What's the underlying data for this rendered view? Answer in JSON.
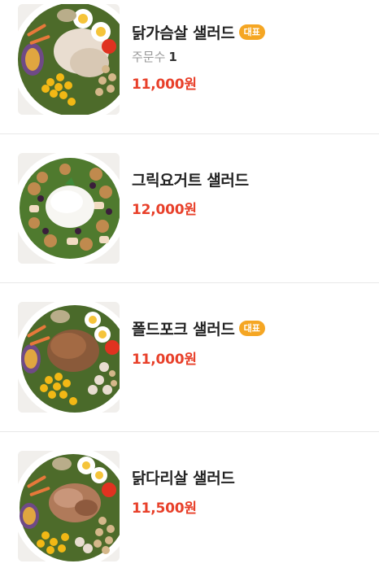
{
  "menu": {
    "items": [
      {
        "image_icon": "salad-photo-icon",
        "name": "닭가슴살 샐러드",
        "badge": "대표",
        "orders_label": "주문수",
        "orders_count": "1",
        "price": "11,000원"
      },
      {
        "image_icon": "salad-photo-icon",
        "name": "그릭요거트 샐러드",
        "price": "12,000원"
      },
      {
        "image_icon": "salad-photo-icon",
        "name": "폴드포크 샐러드",
        "badge": "대표",
        "price": "11,000원"
      },
      {
        "image_icon": "salad-photo-icon",
        "name": "닭다리살 샐러드",
        "price": "11,500원"
      }
    ]
  },
  "colors": {
    "price": "#e8402a",
    "badge": "#f5a623",
    "divider": "#e8e8e8"
  }
}
